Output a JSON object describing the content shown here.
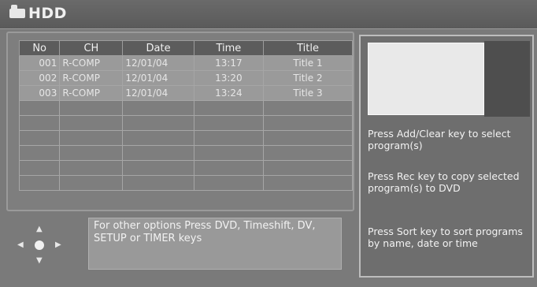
{
  "window": {
    "title": "HDD",
    "icon": "hdd-icon"
  },
  "table": {
    "headers": [
      "No",
      "CH",
      "Date",
      "Time",
      "Title"
    ],
    "rows": [
      {
        "no": "001",
        "ch": "R-COMP",
        "date": "12/01/04",
        "time": "13:17",
        "title": "Title 1"
      },
      {
        "no": "002",
        "ch": "R-COMP",
        "date": "12/01/04",
        "time": "13:20",
        "title": "Title 2"
      },
      {
        "no": "003",
        "ch": "R-COMP",
        "date": "12/01/04",
        "time": "13:24",
        "title": "Title 3"
      }
    ]
  },
  "help": {
    "text": "For other options Press DVD, Timeshift, DV, SETUP or TIMER keys"
  },
  "info": {
    "add_clear": "Press Add/Clear key to select program(s)",
    "rec": "Press Rec key to copy selected program(s) to DVD",
    "sort": "Press Sort key to sort programs by name, date or time"
  },
  "icons": {
    "navigation": "dpad-icon",
    "arrows": [
      "arrow-up-icon",
      "arrow-down-icon",
      "arrow-left-icon",
      "arrow-right-icon"
    ]
  }
}
